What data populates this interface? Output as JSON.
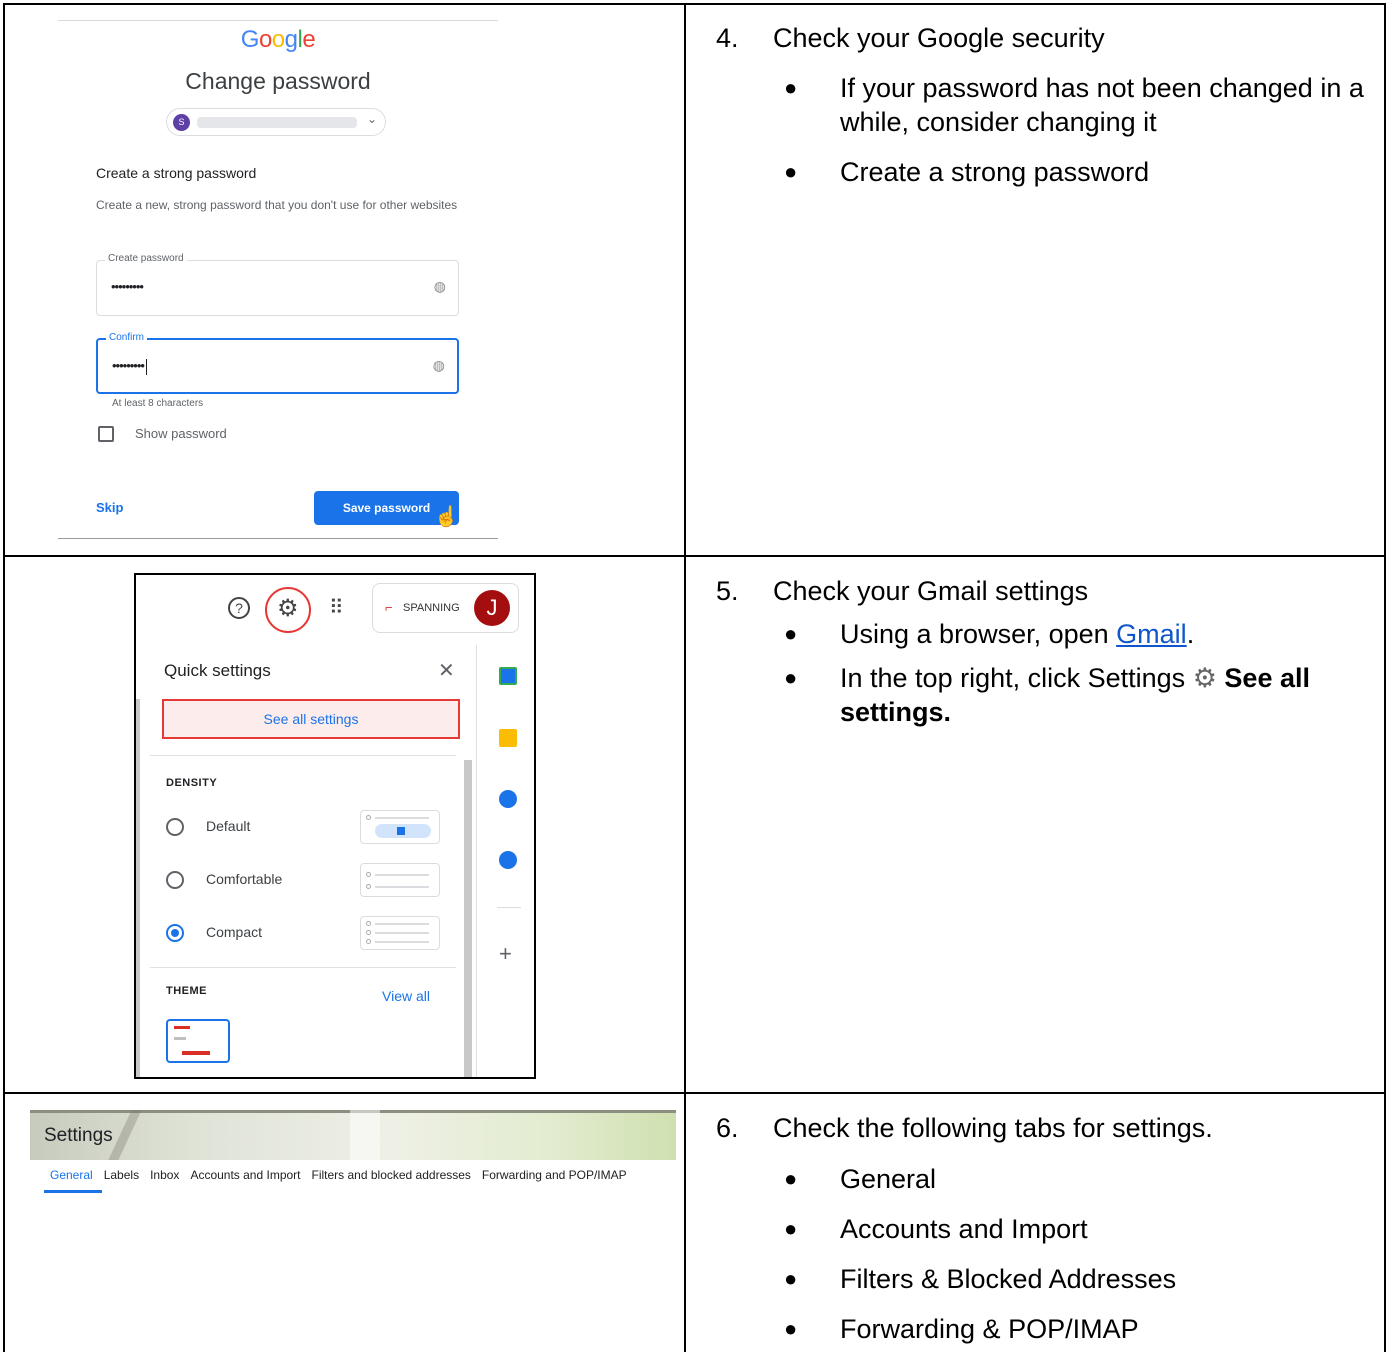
{
  "step4": {
    "number": "4.",
    "title": "Check your Google security",
    "bullets": [
      "If your password has not been changed in a while, consider changing it",
      "Create a strong password"
    ]
  },
  "step5": {
    "number": "5.",
    "title": "Check your Gmail settings",
    "bullet1_prefix": "Using a browser, open ",
    "bullet1_link": "Gmail",
    "bullet1_suffix": ".",
    "bullet2_prefix": "In the top right, click Settings ",
    "bullet2_bold": "See all settings."
  },
  "step6": {
    "number": "6.",
    "title": "Check the following tabs for settings.",
    "bullets": [
      "General",
      "Accounts and Import",
      "Filters & Blocked Addresses",
      "Forwarding & POP/IMAP"
    ]
  },
  "google_change_password": {
    "logo": "Google",
    "title": "Change password",
    "account_initial": "S",
    "heading": "Create a strong password",
    "description": "Create a new, strong password that you don't use for other websites",
    "create_label": "Create password",
    "create_value": "•••••••••",
    "confirm_label": "Confirm",
    "confirm_value": "•••••••••",
    "hint": "At least 8 characters",
    "show_password": "Show password",
    "skip": "Skip",
    "save": "Save password"
  },
  "gmail_quick_settings": {
    "help_glyph": "?",
    "brand": "SPANNING",
    "avatar_initial": "J",
    "title": "Quick settings",
    "see_all": "See all settings",
    "density_heading": "DENSITY",
    "density_options": [
      "Default",
      "Comfortable",
      "Compact"
    ],
    "selected_density": "Compact",
    "theme_heading": "THEME",
    "view_all": "View all"
  },
  "gmail_settings": {
    "title": "Settings",
    "tabs": [
      "General",
      "Labels",
      "Inbox",
      "Accounts and Import",
      "Filters and blocked addresses",
      "Forwarding and POP/IMAP"
    ],
    "active_tab": "General"
  },
  "colors": {
    "google_blue": "#1a73e8",
    "highlight_red": "#e53935",
    "link_blue": "#1155cc"
  }
}
